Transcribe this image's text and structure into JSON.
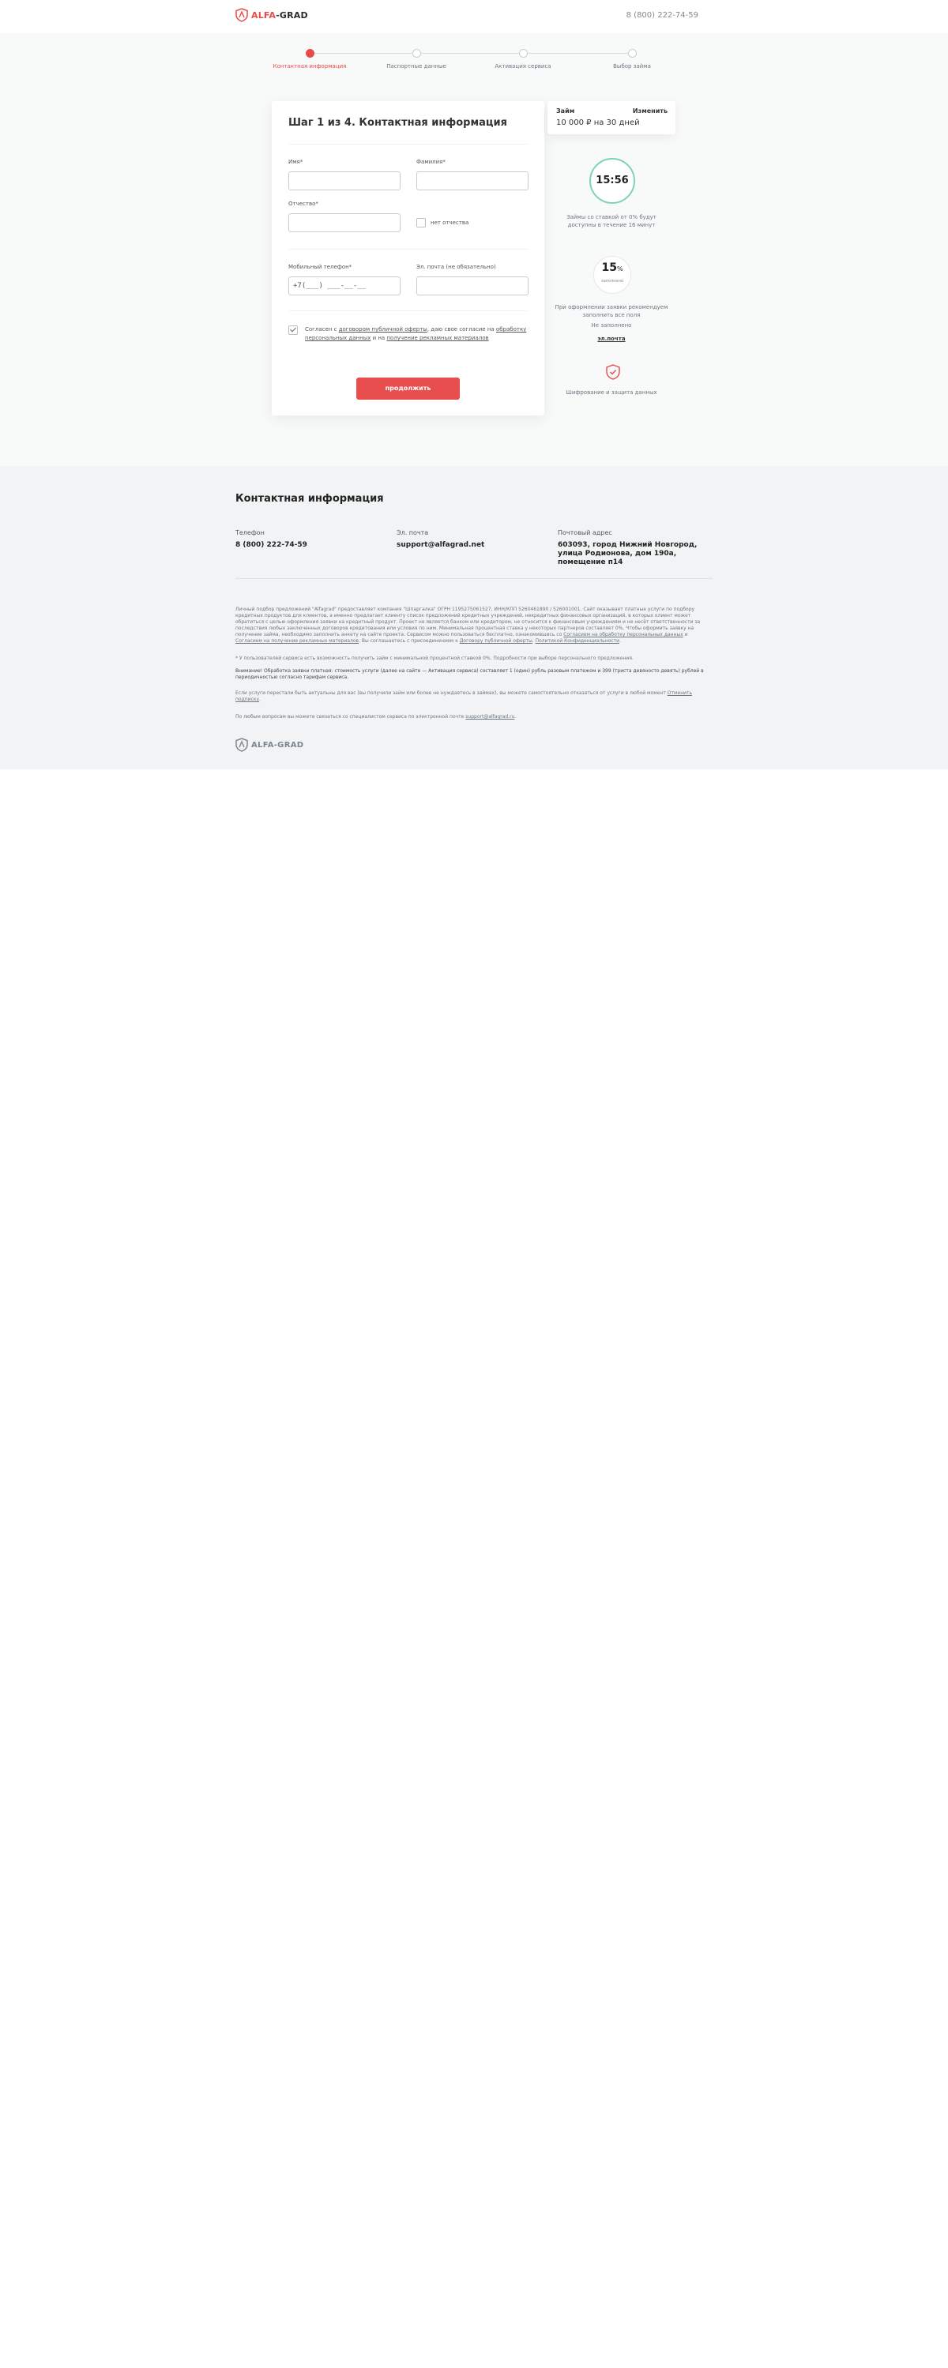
{
  "header": {
    "logo_red": "ALFA",
    "logo_dark": "-GRAD",
    "phone": "8 (800) 222-74-59"
  },
  "stepper": {
    "steps": [
      {
        "label": "Контактная информация",
        "active": true
      },
      {
        "label": "Паспортные данные",
        "active": false
      },
      {
        "label": "Активация сервиса",
        "active": false
      },
      {
        "label": "Выбор займа",
        "active": false
      }
    ]
  },
  "form": {
    "title": "Шаг 1 из 4. Контактная информация",
    "first_name_label": "Имя*",
    "first_name_value": "",
    "last_name_label": "Фамилия*",
    "last_name_value": "",
    "middle_name_label": "Отчество*",
    "middle_name_value": "",
    "no_middle_name_label": "нет отчества",
    "phone_label": "Мобильный телефон*",
    "phone_value": "+7(___) ___-__-__",
    "email_label": "Эл. почта (не обязательно)",
    "email_value": "",
    "consent_p1": "Согласен с ",
    "consent_link1": "договором публичной оферты",
    "consent_p2": ", даю свое согласие на ",
    "consent_link2": "обработку персональных данных",
    "consent_p3": " и на ",
    "consent_link3": "получение рекламных материалов",
    "submit_label": "продолжить"
  },
  "loan": {
    "title": "Займ",
    "change_label": "Изменить",
    "value": "10 000 ₽ на 30 дней"
  },
  "sidebar": {
    "timer": "15:56",
    "timer_text": "Займы со ставкой от 0% будут доступны в течение 16 минут",
    "percent_num": "15",
    "percent_sign": "%",
    "percent_sub": "заполнено",
    "percent_text": "При оформлении заявки рекомендуем заполнить все поля",
    "no_email_text": "Не заполнено",
    "no_email_link": "эл.почта",
    "security_text": "Шифрование и защита данных"
  },
  "footer": {
    "title": "Контактная информация",
    "phone_label": "Телефон",
    "phone_value": "8 (800) 222-74-59",
    "email_label": "Эл. почта",
    "email_value": "support@alfagrad.net",
    "address_label": "Почтовый адрес",
    "address_value": "603093, город Нижний Новгород, улица Родионова, дом 190а, помещение п14",
    "legal1": "Личный подбор предложений \"Alfagrad\" предоставляет компания \"Шпаргалка\" ОГРН 1195275061527, ИНН/КПП 5260461890 / 526001001. Сайт оказывает платные услуги по подбору кредитных продуктов для клиентов, а именно предлагает клиенту список предложений кредитных учреждений, некредитных финансовых организаций, в которых клиент может обратиться с целью оформления заявки на кредитный продукт. Проект не является банком или кредитором, не относится к финансовым учреждениям и не несёт ответственности за последствия любых заключенных договоров кредитования или условия по ним. Минимальная процентная ставка у некоторых партнеров составляет 0%. Чтобы оформить заявку на получение займа, необходимо заполнить анкету на сайте проекта. Сервисом можно пользоваться бесплатно, ознакомившись со ",
    "legal1_link1": "Согласием на обработку персональных данных",
    "legal1_mid": " и ",
    "legal1_link2": "Согласием на получение рекламных материалов",
    "legal1_mid2": ". Вы соглашаетесь с присоединением к ",
    "legal1_link3": "Договору публичной оферты",
    "legal1_sep": ", ",
    "legal1_link4": "Политикой Конфиденциальности",
    "legal1_end": ".",
    "legal2": "* У пользователей сервиса есть возможность получить займ с минимальной процентной ставкой 0%. Подробности при выборе персонального предложения.",
    "legal3": "Внимание! Обработка заявки платная: стоимость услуги (далее на сайте — Активация сервиса) составляет 1 (один) рубль разовым платежом и 399 (триста девяносто девять) рублей в периодичностью согласно тарифам сервиса.",
    "legal4": "Если услуги перестали быть актуальны для вас (вы получили займ или более не нуждаетесь в займах), вы можете самостоятельно отказаться от услуги в любой момент ",
    "legal4_link": "Отменить подписку",
    "legal4_end": ".",
    "legal5": "По любым вопросам вы можете связаться со специалистом сервиса по электронной почте ",
    "legal5_link": "support@alfagrad.ru",
    "legal5_end": ".",
    "logo_text": "ALFA-GRAD"
  },
  "colors": {
    "accent": "#e84a4a",
    "timer_ring": "#7fd1bd",
    "page_bg": "#f8f9f9",
    "footer_bg": "#f1f3f4"
  }
}
